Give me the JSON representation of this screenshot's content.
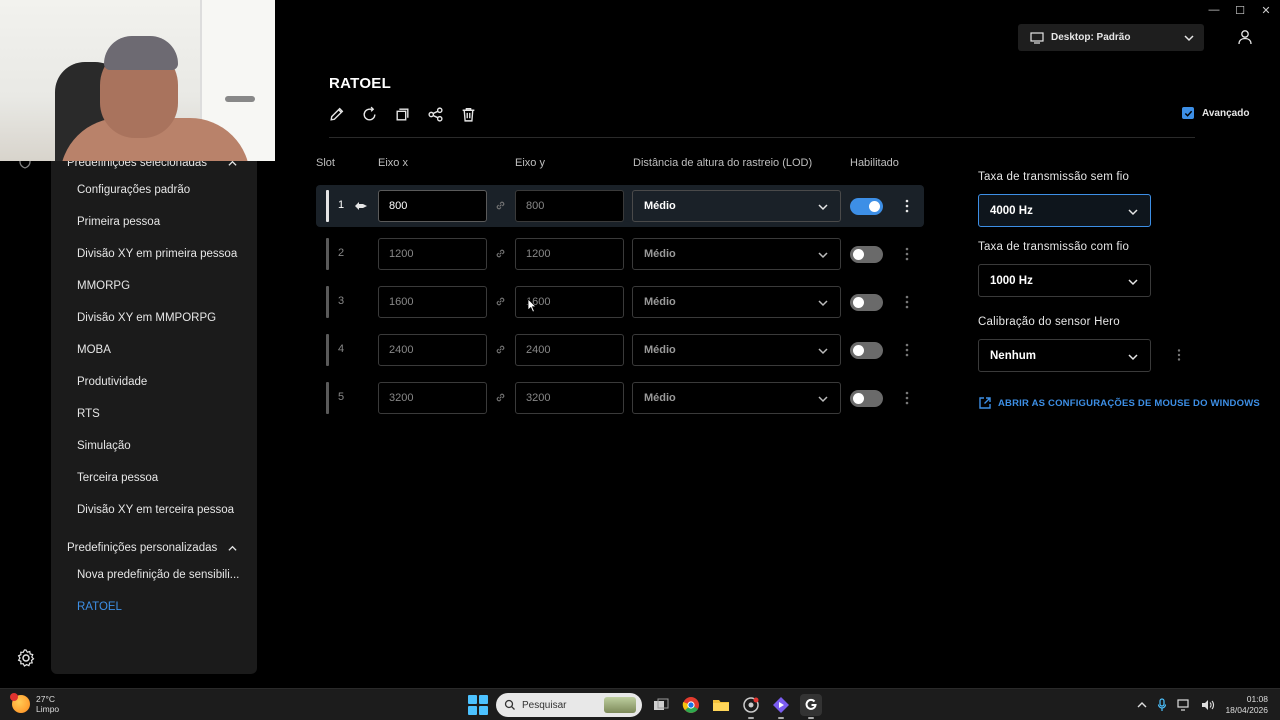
{
  "window": {
    "minimize": "—",
    "maximize": "☐",
    "close": "✕"
  },
  "profile": {
    "label": "Desktop: Padrão"
  },
  "page": {
    "title": "RATOEL"
  },
  "advanced": {
    "label": "Avançado",
    "checked": true
  },
  "sidebar": {
    "group_selected": "Predefinições selecionadas",
    "selected_items": [
      {
        "label": "Configurações padrão"
      },
      {
        "label": "Primeira pessoa"
      },
      {
        "label": "Divisão XY em primeira pessoa"
      },
      {
        "label": "MMORPG"
      },
      {
        "label": "Divisão XY em MMPORPG"
      },
      {
        "label": "MOBA"
      },
      {
        "label": "Produtividade"
      },
      {
        "label": "RTS"
      },
      {
        "label": "Simulação"
      },
      {
        "label": "Terceira pessoa"
      },
      {
        "label": "Divisão XY em terceira pessoa"
      }
    ],
    "group_custom": "Predefinições personalizadas",
    "custom_items": [
      {
        "label": "Nova predefinição de sensibili..."
      },
      {
        "label": "RATOEL",
        "active": true
      }
    ]
  },
  "table": {
    "headers": {
      "slot": "Slot",
      "x": "Eixo x",
      "y": "Eixo y",
      "lod": "Distância de altura do rastreio (LOD)",
      "enabled": "Habilitado"
    },
    "rows": [
      {
        "slot": "1",
        "x": "800",
        "y": "800",
        "lod": "Médio",
        "enabled": true,
        "selected": true
      },
      {
        "slot": "2",
        "x": "1200",
        "y": "1200",
        "lod": "Médio",
        "enabled": false
      },
      {
        "slot": "3",
        "x": "1600",
        "y": "1600",
        "lod": "Médio",
        "enabled": false
      },
      {
        "slot": "4",
        "x": "2400",
        "y": "2400",
        "lod": "Médio",
        "enabled": false
      },
      {
        "slot": "5",
        "x": "3200",
        "y": "3200",
        "lod": "Médio",
        "enabled": false
      }
    ]
  },
  "right_panel": {
    "wireless_label": "Taxa de transmissão sem fio",
    "wireless_value": "4000 Hz",
    "wired_label": "Taxa de transmissão com fio",
    "wired_value": "1000 Hz",
    "hero_label": "Calibração do sensor Hero",
    "hero_value": "Nenhum",
    "windows_link": "ABRIR AS CONFIGURAÇÕES DE MOUSE DO WINDOWS"
  },
  "taskbar": {
    "weather_temp": "27°C",
    "weather_cond": "Limpo",
    "weather_badge": "1",
    "search_placeholder": "Pesquisar",
    "time": "01:08",
    "date": "18/04/2026"
  },
  "colors": {
    "accent": "#3d8fe6",
    "background": "#000000",
    "panel": "#1b1b1b"
  }
}
